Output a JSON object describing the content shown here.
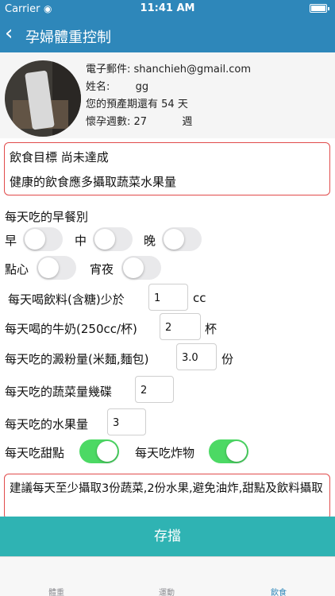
{
  "status_bar": {
    "carrier": "Carrier",
    "wifi_icon": "wifi-icon",
    "time": "11:41 AM",
    "battery_icon": "battery-icon"
  },
  "nav": {
    "back_icon": "chevron-left-icon",
    "title": "孕婦體重控制"
  },
  "profile": {
    "email_label": "電子郵件:",
    "email": "shanchieh@gmail.com",
    "name_label": "姓名:",
    "name": "gg",
    "due_label": "您的預產期還有",
    "due_value": "54",
    "due_unit": "天",
    "weeks_label": "懷孕週數:",
    "weeks_value": "27",
    "weeks_unit": "週"
  },
  "goal": {
    "status": "飲食目標 尚未達成",
    "message": "健康的飲食應多攝取蔬菜水果量"
  },
  "breakfast": {
    "title": "每天吃的早餐別",
    "early_label": "早",
    "early_on": false,
    "noon_label": "中",
    "noon_on": false,
    "night_label": "晚",
    "night_on": false,
    "snack_label": "點心",
    "snack_on": false,
    "late_label": "宵夜",
    "late_on": false
  },
  "drinks": {
    "label": "每天喝飲料(含糖)少於",
    "value": "1",
    "unit": "cc"
  },
  "milk": {
    "label": "每天喝的牛奶(250cc/杯)",
    "value": "2",
    "unit": "杯"
  },
  "starch": {
    "label": "每天吃的澱粉量(米麵,麵包)",
    "value": "3.0",
    "unit": "份"
  },
  "vegetables": {
    "label": "每天吃的蔬菜量幾碟",
    "value": "2"
  },
  "fruit": {
    "label": "每天吃的水果量",
    "value": "3"
  },
  "dessert": {
    "label": "每天吃甜點",
    "on": true
  },
  "fried": {
    "label": "每天吃炸物",
    "on": true
  },
  "advice": "建議每天至少攝取3份蔬菜,2份水果,避免油炸,甜點及飲料攝取",
  "save_label": "存擋",
  "tabs": [
    {
      "label": "體重",
      "active": false
    },
    {
      "label": "運動",
      "active": false
    },
    {
      "label": "飲食",
      "active": true
    }
  ],
  "colors": {
    "nav": "#2e87ba",
    "save": "#2fb3b3",
    "toggle_on": "#4cd964",
    "box_border": "#e14b4b"
  }
}
